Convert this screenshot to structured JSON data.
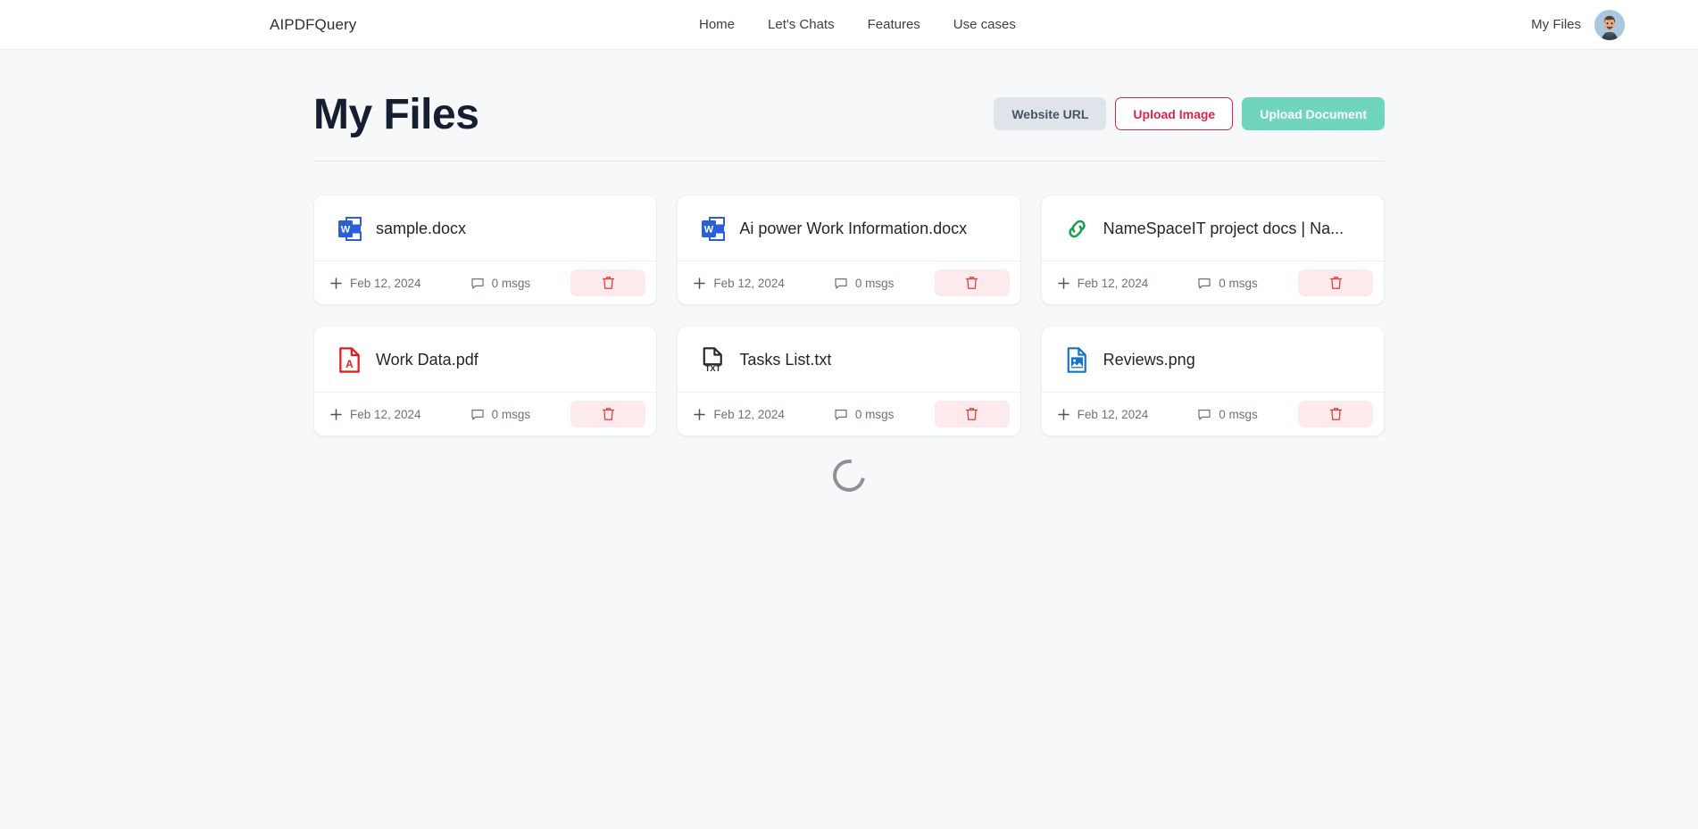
{
  "navbar": {
    "brand": "AIPDFQuery",
    "links": [
      {
        "label": "Home",
        "name": "nav-link-home"
      },
      {
        "label": "Let's Chats",
        "name": "nav-link-lets-chats"
      },
      {
        "label": "Features",
        "name": "nav-link-features"
      },
      {
        "label": "Use cases",
        "name": "nav-link-use-cases"
      }
    ],
    "my_files": "My Files",
    "avatar_icon": "user-avatar"
  },
  "header": {
    "title": "My Files",
    "buttons": {
      "website_url": "Website URL",
      "upload_image": "Upload Image",
      "upload_document": "Upload Document"
    }
  },
  "colors": {
    "page_bg": "#f7f8fa",
    "card_bg": "#ffffff",
    "title": "#161f32",
    "website_btn_bg": "#dfe3ea",
    "upload_image_accent": "#e2214a",
    "upload_doc_bg": "#6fd6bd",
    "delete_bg": "#fdeaec",
    "delete_icon": "#e53935",
    "word_blue": "#2b5fd9",
    "pdf_red": "#e02020",
    "link_green": "#18a04a",
    "txt_dark": "#26282c",
    "png_blue": "#1274c4"
  },
  "files": [
    {
      "name": "sample.docx",
      "icon": "word-document-icon",
      "type": "docx",
      "date": "Feb 12, 2024",
      "msgs": "0 msgs",
      "add_icon": "plus-icon",
      "msgs_icon": "comment-icon",
      "delete_icon": "trash-icon"
    },
    {
      "name": "Ai power Work Information.docx",
      "icon": "word-document-icon",
      "type": "docx",
      "date": "Feb 12, 2024",
      "msgs": "0 msgs",
      "add_icon": "plus-icon",
      "msgs_icon": "comment-icon",
      "delete_icon": "trash-icon"
    },
    {
      "name": "NameSpaceIT project docs | Na...",
      "icon": "link-chain-icon",
      "type": "url",
      "date": "Feb 12, 2024",
      "msgs": "0 msgs",
      "add_icon": "plus-icon",
      "msgs_icon": "comment-icon",
      "delete_icon": "trash-icon"
    },
    {
      "name": "Work Data.pdf",
      "icon": "pdf-document-icon",
      "type": "pdf",
      "date": "Feb 12, 2024",
      "msgs": "0 msgs",
      "add_icon": "plus-icon",
      "msgs_icon": "comment-icon",
      "delete_icon": "trash-icon"
    },
    {
      "name": "Tasks List.txt",
      "icon": "txt-document-icon",
      "type": "txt",
      "date": "Feb 12, 2024",
      "msgs": "0 msgs",
      "add_icon": "plus-icon",
      "msgs_icon": "comment-icon",
      "delete_icon": "trash-icon"
    },
    {
      "name": "Reviews.png",
      "icon": "image-document-icon",
      "type": "png",
      "date": "Feb 12, 2024",
      "msgs": "0 msgs",
      "add_icon": "plus-icon",
      "msgs_icon": "comment-icon",
      "delete_icon": "trash-icon"
    }
  ],
  "loading": {
    "icon": "loading-spinner",
    "visible": true
  }
}
